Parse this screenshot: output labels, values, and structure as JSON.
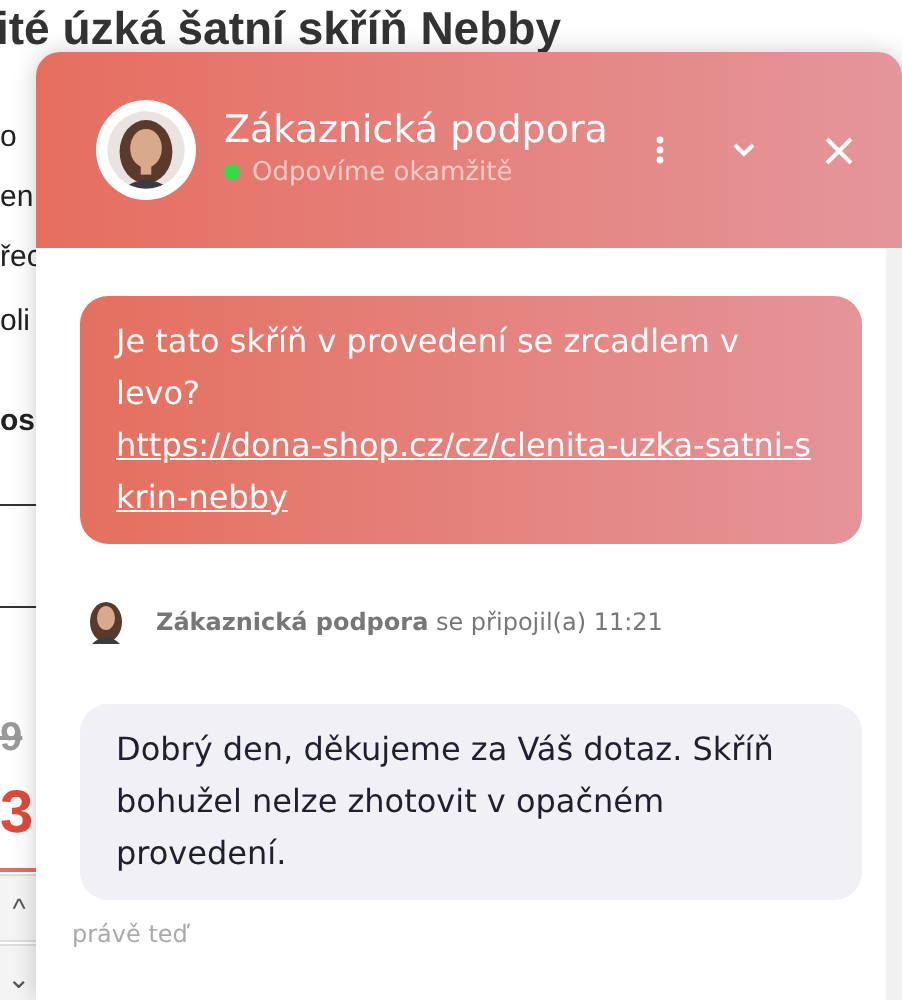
{
  "page": {
    "title": "ité úzká šatní skříň Nebby",
    "fragments": [
      {
        "text": "o",
        "kind": "text"
      },
      {
        "text": "en",
        "kind": "text"
      },
      {
        "text": "řec",
        "kind": "text"
      },
      {
        "text": "oli",
        "kind": "text"
      },
      {
        "text": "os",
        "kind": "bold"
      }
    ],
    "old_price": "9",
    "price": "3",
    "steppers": [
      "^",
      "⌄"
    ]
  },
  "chat": {
    "header": {
      "title": "Zákaznická podpora",
      "status": "Odpovíme okamžitě",
      "online": true
    },
    "messages": [
      {
        "kind": "outgoing",
        "text": "Je tato skříň v provedení se zrcadlem v levo? ",
        "link": "https://dona-shop.cz/cz/clenita-uzka-satni-skrin-nebby"
      },
      {
        "kind": "event",
        "name": "Zákaznická podpora",
        "text": "se připojil(a) 11:21"
      },
      {
        "kind": "incoming",
        "text": "Dobrý den, děkujeme za Váš dotaz. Skříň bohužel nelze zhotovit v opačném provedení.",
        "time": "právě teď"
      }
    ]
  }
}
